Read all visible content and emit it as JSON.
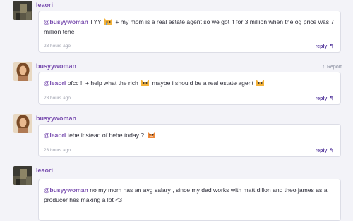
{
  "comments": [
    {
      "username": "leaori",
      "avatar": "avatar-dark-icon",
      "mention": "@busyywoman",
      "text_before_emoji": " TYY ",
      "text_after_emoji": " + my mom is a real estate agent so we got it for 3 million when the og price was 7 million tehe",
      "time": "23 hours ago",
      "reply_label": "reply",
      "report_label": ""
    },
    {
      "username": "busyywoman",
      "avatar": "avatar-portrait-icon",
      "mention": "@leaori",
      "text_before_emoji": " ofcc !! + help what the rich ",
      "text_mid_emoji": " maybe i should be a real estate agent ",
      "time": "23 hours ago",
      "reply_label": "reply",
      "report_label": "Report"
    },
    {
      "username": "busyywoman",
      "avatar": "avatar-portrait-icon",
      "mention": "@leaori",
      "text_before_emoji": " tehe instead of hehe today ? ",
      "time": "23 hours ago",
      "reply_label": "reply",
      "report_label": ""
    },
    {
      "username": "leaori",
      "avatar": "avatar-dark-icon",
      "mention": "@busyywoman",
      "text_before_emoji": " no my mom has an avg salary , since my dad works with matt dillon and theo james as a producer hes making a lot <3",
      "time": "23 hours ago",
      "reply_label": "reply",
      "report_label": ""
    }
  ],
  "colors": {
    "username": "#7a4fb0",
    "reply": "#5a3fa0",
    "background": "#f3f3f8"
  }
}
